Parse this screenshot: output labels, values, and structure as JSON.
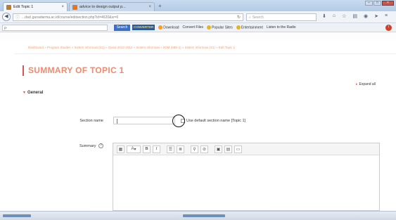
{
  "browser": {
    "tabs": [
      {
        "title": "Edit Topic 1",
        "favicon_color": "#c07a2e",
        "active": true
      },
      {
        "title": "advice to design output p...",
        "favicon_color": "#e8741f",
        "active": false
      }
    ],
    "new_tab_label": "+",
    "address": "...dacl.gunadarma.ac.id/course/editsection.php?id=4620&sr=0",
    "search_placeholder": "Search",
    "toolbar2": {
      "search_button": "Search",
      "logo": "CONVERTER",
      "download": "Download",
      "convert_files": "Convert Files",
      "popular_sites": "Popular Sites",
      "entertainment": "Entertainment",
      "listen_radio": "Listen to the Radio"
    }
  },
  "page": {
    "breadcrumb": {
      "trail": "Dashboard » Program Studies » Sistem Informasi (S1) » Gasal 2013-2014 » Sistem Informasi » IIDM (MBI-1) » Sistem Informasi (S1) » Edit Topic 1",
      "current": "Edit Topic 1"
    },
    "title": "SUMMARY OF TOPIC 1",
    "expand_all": "Expand all",
    "general_label": "General",
    "form": {
      "section_name_label": "Section name",
      "section_name_value": "",
      "use_default_label": "Use default section name [Topic 1]",
      "summary_label": "Summary",
      "help_icon": "?"
    },
    "editor_toolbar": [
      "A",
      "B",
      "I",
      "bulleted-list",
      "numbered-list",
      "link",
      "unlink",
      "image",
      "media",
      "file"
    ]
  },
  "colors": {
    "accent": "#d9534f",
    "title": "#ef8a6f",
    "breadcrumb": "#e9a27a"
  }
}
